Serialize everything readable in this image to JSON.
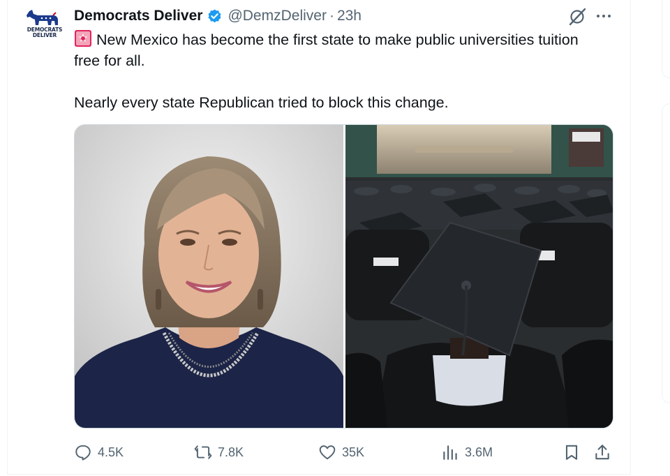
{
  "author": {
    "display_name": "Democrats Deliver",
    "handle": "@DemzDeliver",
    "separator": "·",
    "timestamp": "23h",
    "avatar_text_line1": "DEMOCRATS",
    "avatar_text_line2": "DELIVER",
    "verified": true
  },
  "tweet": {
    "flag_icon": "rotating-light-emoji",
    "line1": "New Mexico has become the first state to make public universities tuition free for all.",
    "line2": "Nearly every state Republican tried to block this change."
  },
  "media": {
    "left_image": "portrait-of-woman-with-bob-haircut",
    "right_image": "graduates-in-caps-and-gowns"
  },
  "actions": {
    "replies": "4.5K",
    "reposts": "7.8K",
    "likes": "35K",
    "views": "3.6M"
  },
  "colors": {
    "text": "#0f1419",
    "secondary": "#536471",
    "verified": "#1d9bf0",
    "border": "#cfd9de"
  }
}
